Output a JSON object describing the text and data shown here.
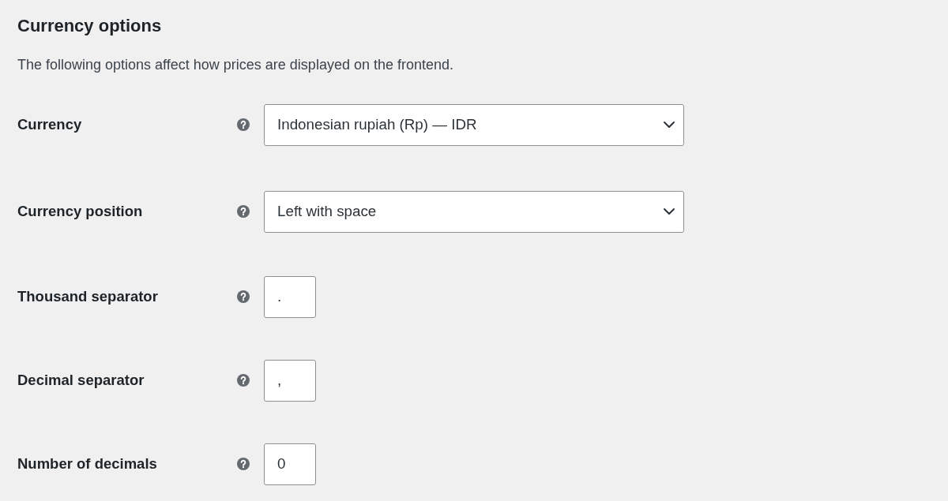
{
  "section": {
    "title": "Currency options",
    "description": "The following options affect how prices are displayed on the frontend."
  },
  "fields": [
    {
      "kind": "select",
      "label": "Currency",
      "value": "Indonesian rupiah (Rp) — IDR"
    },
    {
      "kind": "select",
      "label": "Currency position",
      "value": "Left with space"
    },
    {
      "kind": "text",
      "label": "Thousand separator",
      "value": "."
    },
    {
      "kind": "text",
      "label": "Decimal separator",
      "value": ","
    },
    {
      "kind": "text",
      "label": "Number of decimals",
      "value": "0"
    }
  ]
}
